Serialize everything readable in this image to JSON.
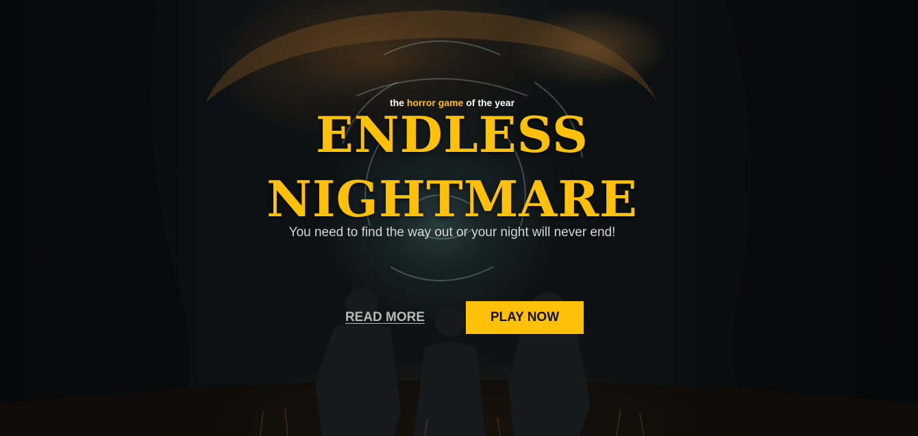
{
  "hero": {
    "tagline_prefix": "the",
    "tagline_accent": "horror game",
    "tagline_suffix": "of the year",
    "title_line1": "ENDLESS",
    "title_line2": "NIGHTMARE",
    "subtitle": "You need to find the way out or your night will never end!",
    "read_more_label": "READ MORE",
    "play_now_label": "PLAY NOW"
  },
  "colors": {
    "accent": "#ffc107",
    "background": "#050506",
    "subtitle_text": "#d6d6d6",
    "secondary_button_text": "#b9b9b9"
  }
}
